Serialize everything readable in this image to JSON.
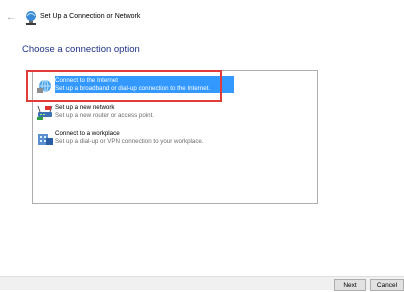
{
  "window": {
    "title": "Set Up a Connection or Network",
    "back_icon": "back-arrow-icon"
  },
  "page": {
    "heading": "Choose a connection option"
  },
  "options": [
    {
      "title": "Connect to the Internet",
      "description": "Set up a broadband or dial-up connection to the Internet.",
      "icon": "globe-network-icon",
      "selected": true
    },
    {
      "title": "Set up a new network",
      "description": "Set up a new router or access point.",
      "icon": "router-icon",
      "selected": false
    },
    {
      "title": "Connect to a workplace",
      "description": "Set up a dial-up or VPN connection to your workplace.",
      "icon": "workplace-icon",
      "selected": false
    }
  ],
  "buttons": {
    "next": "Next",
    "cancel": "Cancel"
  },
  "colors": {
    "heading": "#1e3287",
    "selection": "#3399ff",
    "highlight": "#e23b3b"
  }
}
